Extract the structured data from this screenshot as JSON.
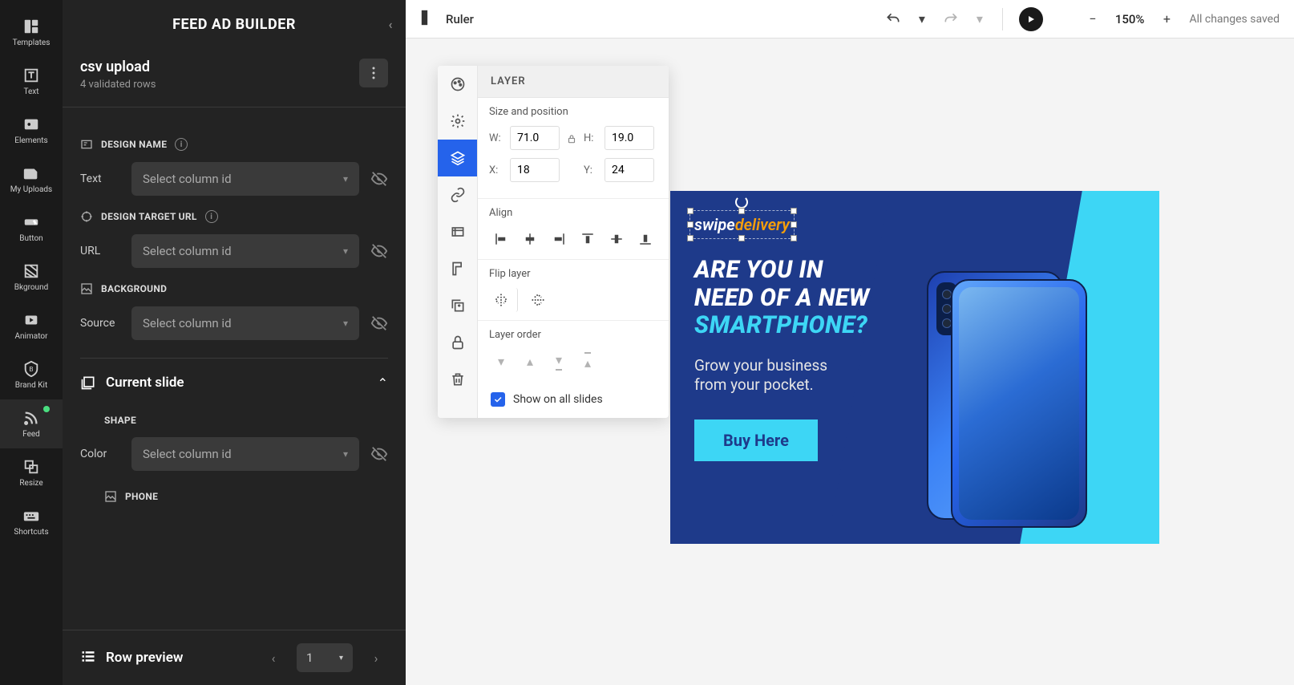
{
  "leftToolbar": [
    {
      "label": "Templates",
      "icon": "templates"
    },
    {
      "label": "Text",
      "icon": "text"
    },
    {
      "label": "Elements",
      "icon": "elements"
    },
    {
      "label": "My Uploads",
      "icon": "uploads"
    },
    {
      "label": "Button",
      "icon": "button"
    },
    {
      "label": "Bkground",
      "icon": "background"
    },
    {
      "label": "Animator",
      "icon": "animator"
    },
    {
      "label": "Brand Kit",
      "icon": "brandkit"
    },
    {
      "label": "Feed",
      "icon": "feed",
      "active": true,
      "dot": true
    },
    {
      "label": "Resize",
      "icon": "resize"
    },
    {
      "label": "Shortcuts",
      "icon": "shortcuts"
    }
  ],
  "sidebar": {
    "title": "FEED AD BUILDER",
    "upload": {
      "title": "csv upload",
      "subtitle": "4 validated rows"
    },
    "fields": {
      "designName": {
        "heading": "DESIGN NAME",
        "label": "Text",
        "placeholder": "Select column id"
      },
      "targetUrl": {
        "heading": "DESIGN TARGET URL",
        "label": "URL",
        "placeholder": "Select column id"
      },
      "background": {
        "heading": "BACKGROUND",
        "label": "Source",
        "placeholder": "Select column id"
      },
      "shape": {
        "heading": "SHAPE",
        "label": "Color",
        "placeholder": "Select column id"
      },
      "phone": {
        "heading": "PHONE"
      }
    },
    "currentSlide": "Current slide",
    "rowPreview": {
      "label": "Row preview",
      "value": "1"
    }
  },
  "topbar": {
    "ruler": "Ruler",
    "zoom": "150%",
    "saveStatus": "All changes saved"
  },
  "layerPanel": {
    "title": "LAYER",
    "sizePosition": "Size and position",
    "w": "71.0",
    "h": "19.0",
    "x": "18",
    "y": "24",
    "wLabel": "W:",
    "hLabel": "H:",
    "xLabel": "X:",
    "yLabel": "Y:",
    "align": "Align",
    "flip": "Flip layer",
    "order": "Layer order",
    "showAll": "Show on all slides"
  },
  "ad": {
    "logo1": "swipe",
    "logo2": "delivery",
    "headline1": "ARE YOU IN",
    "headline2": "NEED OF A NEW",
    "headline3": "SMARTPHONE?",
    "sub1": "Grow your business",
    "sub2": "from your pocket.",
    "cta": "Buy Here"
  }
}
